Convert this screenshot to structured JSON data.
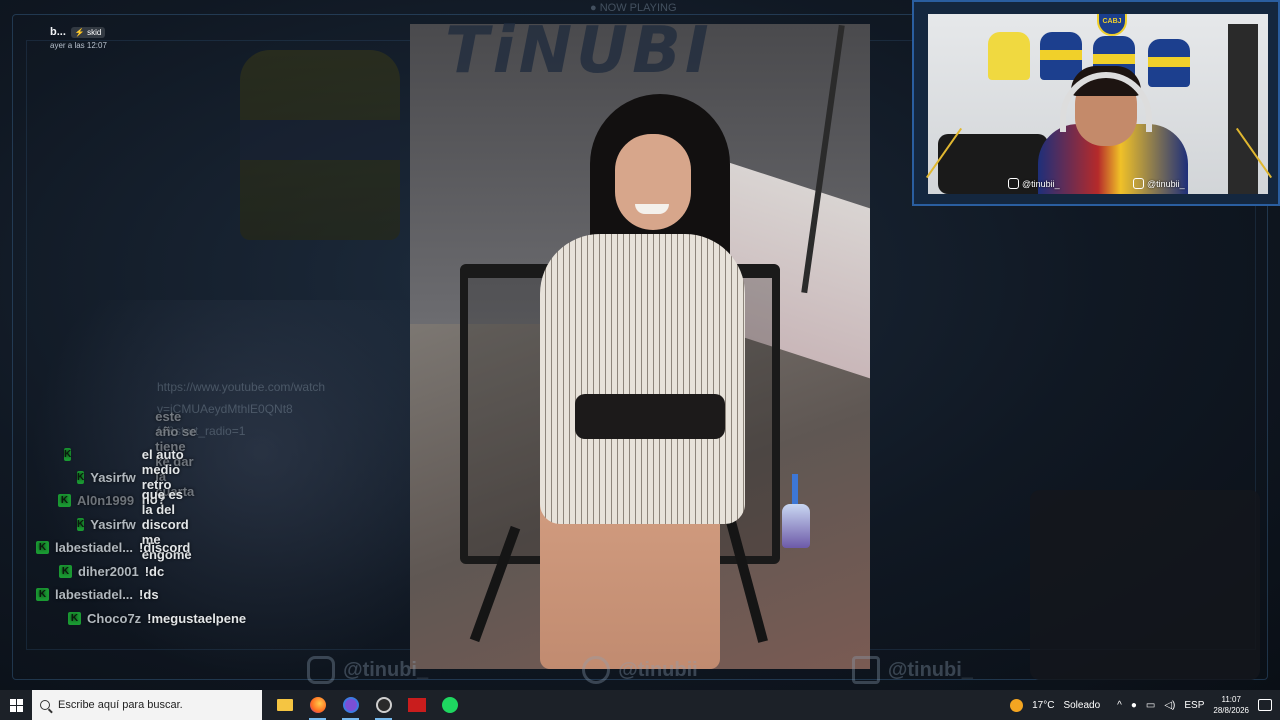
{
  "overlay": {
    "top_label": "● NOW PLAYING",
    "logo_text": "TiNUBI",
    "discord": {
      "username": "b...",
      "tag": "skid",
      "time": "ayer a las 12:07"
    },
    "ghost_lines": [
      "https://www.youtube.com/watch",
      "v=jCMUAeydMthlE0QNt8",
      "f4&start_radio=1"
    ]
  },
  "chat": {
    "messages": [
      {
        "user": "",
        "text": "este año se tiene ke dar la cuarta",
        "faded": true
      },
      {
        "user": "Yasirfw",
        "text": "el auto medio retro no?",
        "faded": false
      },
      {
        "user": "Al0n1999",
        "text": "",
        "faded": true
      },
      {
        "user": "Yasirfw",
        "text": "que es la del discord me engome",
        "faded": false
      },
      {
        "user": "labestiadel...",
        "text": "!discord",
        "faded": false
      },
      {
        "user": "diher2001",
        "text": "!dc",
        "faded": false
      },
      {
        "user": "labestiadel...",
        "text": "!ds",
        "faded": false
      },
      {
        "user": "Choco7z",
        "text": "!megustaelpene",
        "faded": false
      }
    ]
  },
  "webcam": {
    "crest": "CABJ",
    "instagram_handle": "@tinubii_",
    "tiktok_handle": "@tinubii_"
  },
  "socials": [
    {
      "icon": "instagram-icon",
      "handle": "@tinubi_"
    },
    {
      "icon": "twitter-icon",
      "handle": "@tinubii"
    },
    {
      "icon": "tiktok-icon",
      "handle": "@tinubi_"
    }
  ],
  "taskbar": {
    "search_placeholder": "Escribe aquí para buscar.",
    "weather_temp": "17°C",
    "weather_desc": "Soleado",
    "language": "ESP",
    "time": "11:07",
    "date": "28/8/2026",
    "apps": [
      "file-explorer-icon",
      "firefox-icon",
      "chat-app-icon",
      "obs-icon",
      "news-app-icon",
      "spotify-icon"
    ]
  },
  "colors": {
    "accent": "#2a5ea0",
    "kick_green": "#1b9b33",
    "taskbar": "#1c2128"
  }
}
